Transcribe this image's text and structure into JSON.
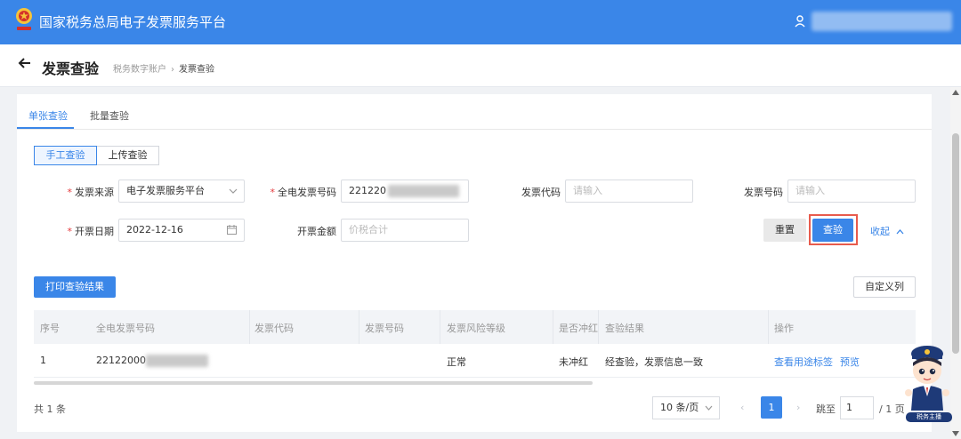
{
  "app": {
    "title": "国家税务总局电子发票服务平台"
  },
  "page": {
    "title": "发票查验",
    "breadcrumb": [
      "税务数字账户",
      "发票查验"
    ]
  },
  "tabs": [
    {
      "label": "单张查验",
      "active": true
    },
    {
      "label": "批量查验",
      "active": false
    }
  ],
  "mode": [
    {
      "label": "手工查验",
      "active": true
    },
    {
      "label": "上传查验",
      "active": false
    }
  ],
  "form": {
    "invoice_source": {
      "label": "发票来源",
      "required": true,
      "value": "电子发票服务平台"
    },
    "full_invoice_number": {
      "label": "全电发票号码",
      "required": true,
      "value": "221220"
    },
    "invoice_code": {
      "label": "发票代码",
      "placeholder": "请输入"
    },
    "invoice_number": {
      "label": "发票号码",
      "placeholder": "请输入"
    },
    "issue_date": {
      "label": "开票日期",
      "required": true,
      "value": "2022-12-16"
    },
    "amount": {
      "label": "开票金额",
      "placeholder": "价税合计"
    }
  },
  "actions": {
    "reset": "重置",
    "check": "查验",
    "collapse": "收起"
  },
  "toolbar": {
    "print": "打印查验结果",
    "custom_columns": "自定义列"
  },
  "table": {
    "headers": [
      "序号",
      "全电发票号码",
      "发票代码",
      "发票号码",
      "发票风险等级",
      "是否冲红",
      "查验结果",
      "操作"
    ],
    "rows": [
      {
        "index": "1",
        "full_invoice_number": "22122000",
        "invoice_code": "",
        "invoice_number": "",
        "risk_level": "正常",
        "red_flush": "未冲红",
        "result": "经查验，发票信息一致",
        "op_view": "查看用途标签",
        "op_preview": "预览"
      }
    ]
  },
  "pagination": {
    "total": "共 1 条",
    "page_size": "10 条/页",
    "prev": "‹",
    "next": "›",
    "current": "1",
    "goto_label": "跳至",
    "goto_value": "1",
    "total_pages": "/ 1 页"
  },
  "mascot": {
    "caption": "税务主播"
  },
  "colors": {
    "primary": "#3a86e8",
    "danger": "#e4393c",
    "highlight_frame": "#e85b4d"
  }
}
